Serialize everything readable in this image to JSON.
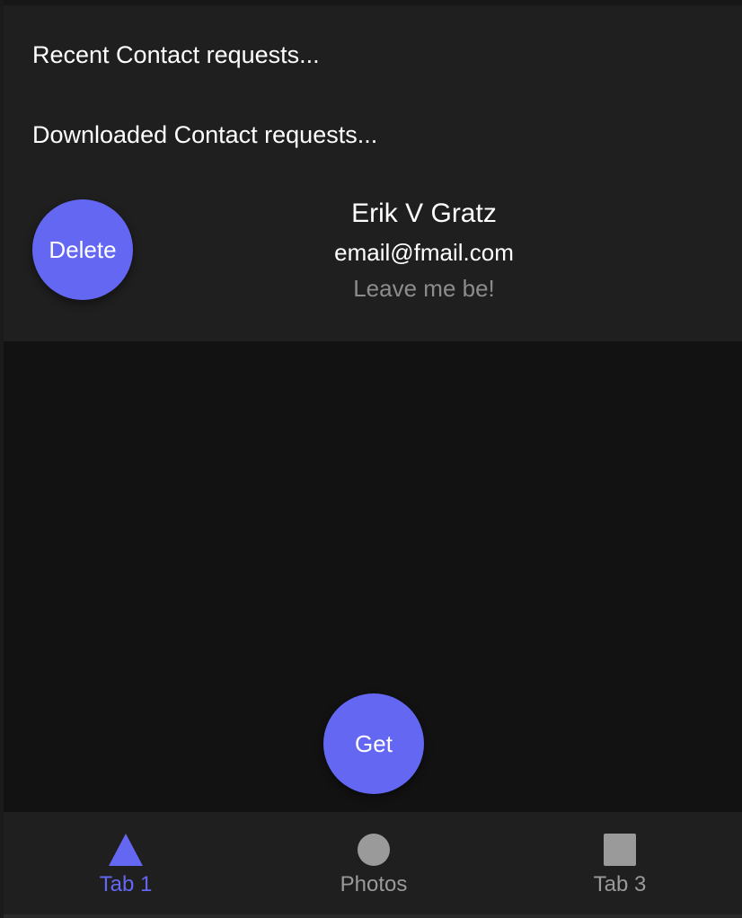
{
  "sections": {
    "recent_label": "Recent Contact requests...",
    "downloaded_label": "Downloaded Contact requests..."
  },
  "contact": {
    "name": "Erik V Gratz",
    "email": "email@fmail.com",
    "message": "Leave me be!",
    "delete_label": "Delete"
  },
  "main": {
    "get_label": "Get"
  },
  "tabbar": {
    "tabs": [
      {
        "label": "Tab 1",
        "icon": "triangle-icon",
        "selected": true
      },
      {
        "label": "Photos",
        "icon": "circle-icon",
        "selected": false
      },
      {
        "label": "Tab 3",
        "icon": "square-icon",
        "selected": false
      }
    ]
  },
  "colors": {
    "accent": "#6467f2",
    "panel_background": "#1f1f1f",
    "content_background": "#121212",
    "inactive_tab": "#9a9a9a",
    "muted_text": "#8c8c8c"
  }
}
